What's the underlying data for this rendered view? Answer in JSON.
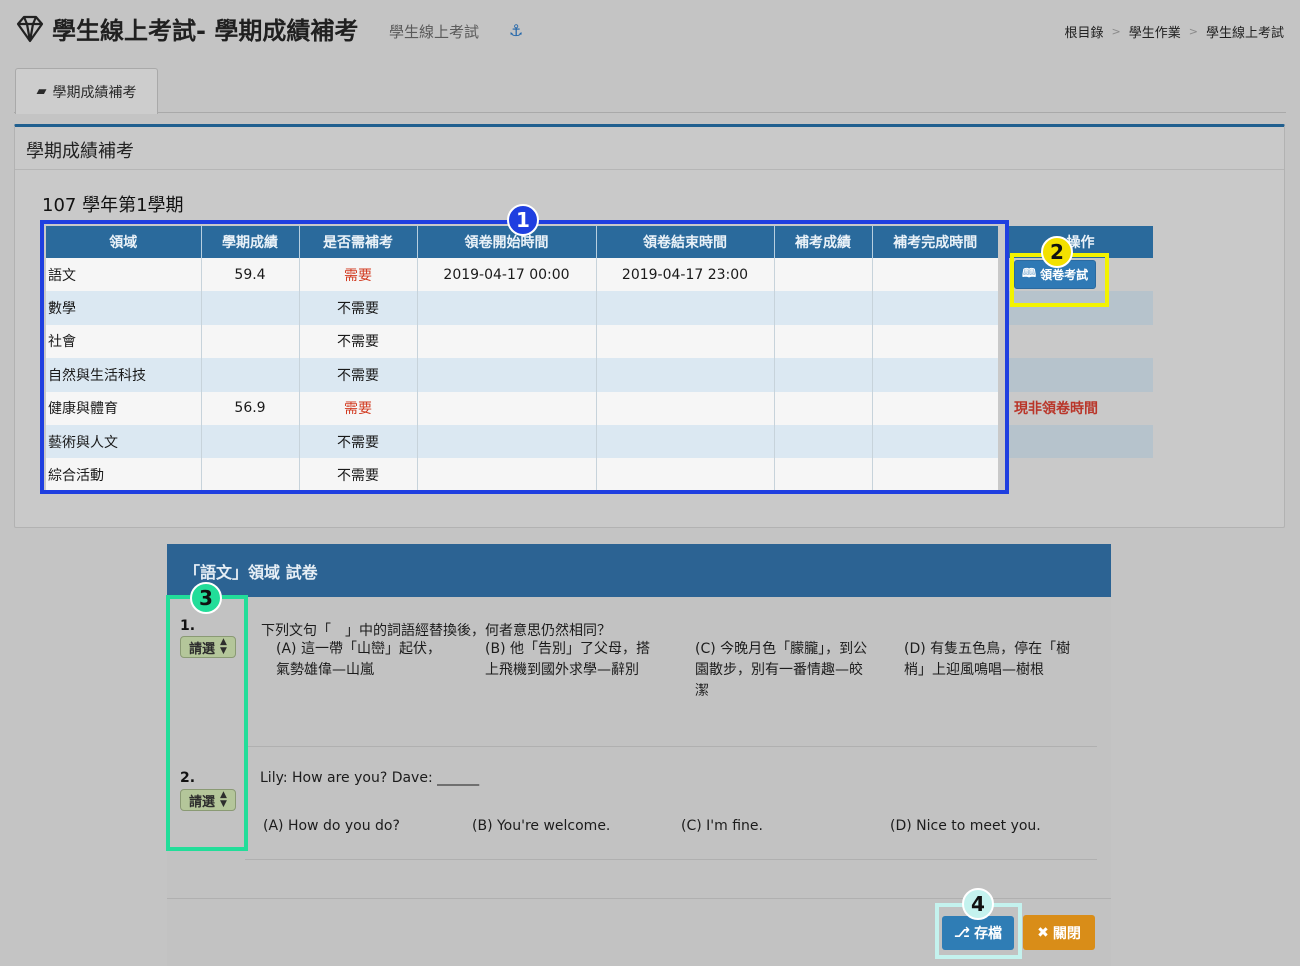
{
  "header": {
    "title": "學生線上考試- 學期成績補考",
    "subtitle": "學生線上考試",
    "breadcrumb": [
      "根目錄",
      "學生作業",
      "學生線上考試"
    ]
  },
  "tab": {
    "label": "學期成績補考"
  },
  "panel": {
    "title": "學期成績補考",
    "semester": "107 學年第1學期"
  },
  "table": {
    "headers": [
      "領域",
      "學期成績",
      "是否需補考",
      "領卷開始時間",
      "領卷結束時間",
      "補考成績",
      "補考完成時間",
      "操作"
    ],
    "rows": [
      [
        "語文",
        "59.4",
        "需要",
        "2019-04-17 00:00",
        "2019-04-17 23:00",
        "",
        "",
        ""
      ],
      [
        "數學",
        "",
        "不需要",
        "",
        "",
        "",
        "",
        ""
      ],
      [
        "社會",
        "",
        "不需要",
        "",
        "",
        "",
        "",
        ""
      ],
      [
        "自然與生活科技",
        "",
        "不需要",
        "",
        "",
        "",
        "",
        ""
      ],
      [
        "健康與體育",
        "56.9",
        "需要",
        "",
        "",
        "",
        "",
        "現非領卷時間"
      ],
      [
        "藝術與人文",
        "",
        "不需要",
        "",
        "",
        "",
        "",
        ""
      ],
      [
        "綜合活動",
        "",
        "不需要",
        "",
        "",
        "",
        "",
        ""
      ]
    ],
    "take_exam_label": "領卷考試"
  },
  "badges": [
    "1",
    "2",
    "3",
    "4"
  ],
  "exam": {
    "title": "「語文」領域 試卷",
    "select_label": "請選",
    "questions": [
      {
        "num": "1.",
        "text": "下列文句「　」中的詞語經替換後，何者意思仍然相同？",
        "options": [
          "(A) 這一帶「山巒」起伏，氣勢雄偉—山嵐",
          "(B) 他「告別」了父母，搭上飛機到國外求學—辭別",
          "(C) 今晚月色「朦朧」，到公園散步，別有一番情趣—皎潔",
          "(D) 有隻五色鳥，停在「樹梢」上迎風鳴唱—樹根"
        ]
      },
      {
        "num": "2.",
        "text": "Lily: How are you? Dave: ______",
        "options": [
          "(A) How do you do?",
          "(B) You're welcome.",
          "(C) I'm fine.",
          "(D) Nice to meet you."
        ]
      }
    ],
    "save_label": "存檔",
    "close_label": "關閉"
  },
  "colors": {
    "header_blue": "#2a6a9c",
    "need_red": "#d23a20",
    "save_blue": "#2f7db5",
    "close_orange": "#d98d18",
    "highlight_1": "#1f3fe0",
    "highlight_2": "#f3f300",
    "highlight_3": "#22dd99",
    "highlight_4": "#c4f2ee"
  }
}
